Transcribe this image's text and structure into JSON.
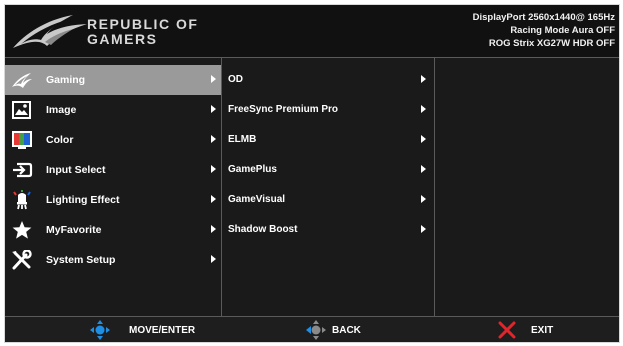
{
  "brand": {
    "line1": "REPUBLIC OF",
    "line2": "GAMERS",
    "logo_icon": "rog-eye-icon"
  },
  "status": {
    "line1": "DisplayPort  2560x1440@  165Hz",
    "line2": "Racing Mode Aura OFF",
    "line3": "ROG Strix XG27W HDR OFF"
  },
  "menu": {
    "items": [
      {
        "label": "Gaming",
        "icon": "rog-eye-icon",
        "selected": true
      },
      {
        "label": "Image",
        "icon": "image-icon"
      },
      {
        "label": "Color",
        "icon": "color-icon"
      },
      {
        "label": "Input Select",
        "icon": "input-select-icon"
      },
      {
        "label": "Lighting Effect",
        "icon": "lighting-effect-icon"
      },
      {
        "label": "MyFavorite",
        "icon": "star-icon"
      },
      {
        "label": "System Setup",
        "icon": "wrench-screwdriver-icon"
      }
    ]
  },
  "submenu": {
    "items": [
      {
        "label": "OD"
      },
      {
        "label": "FreeSync Premium Pro"
      },
      {
        "label": "ELMB"
      },
      {
        "label": "GamePlus"
      },
      {
        "label": "GameVisual"
      },
      {
        "label": "Shadow Boost"
      }
    ]
  },
  "footer": {
    "move_enter": "MOVE/ENTER",
    "back": "BACK",
    "exit": "EXIT"
  },
  "colors": {
    "background": "#1a1a1a",
    "selected_item": "#9a9a9a",
    "joystick_blue": "#1e8fe6",
    "exit_red": "#e0262d"
  }
}
